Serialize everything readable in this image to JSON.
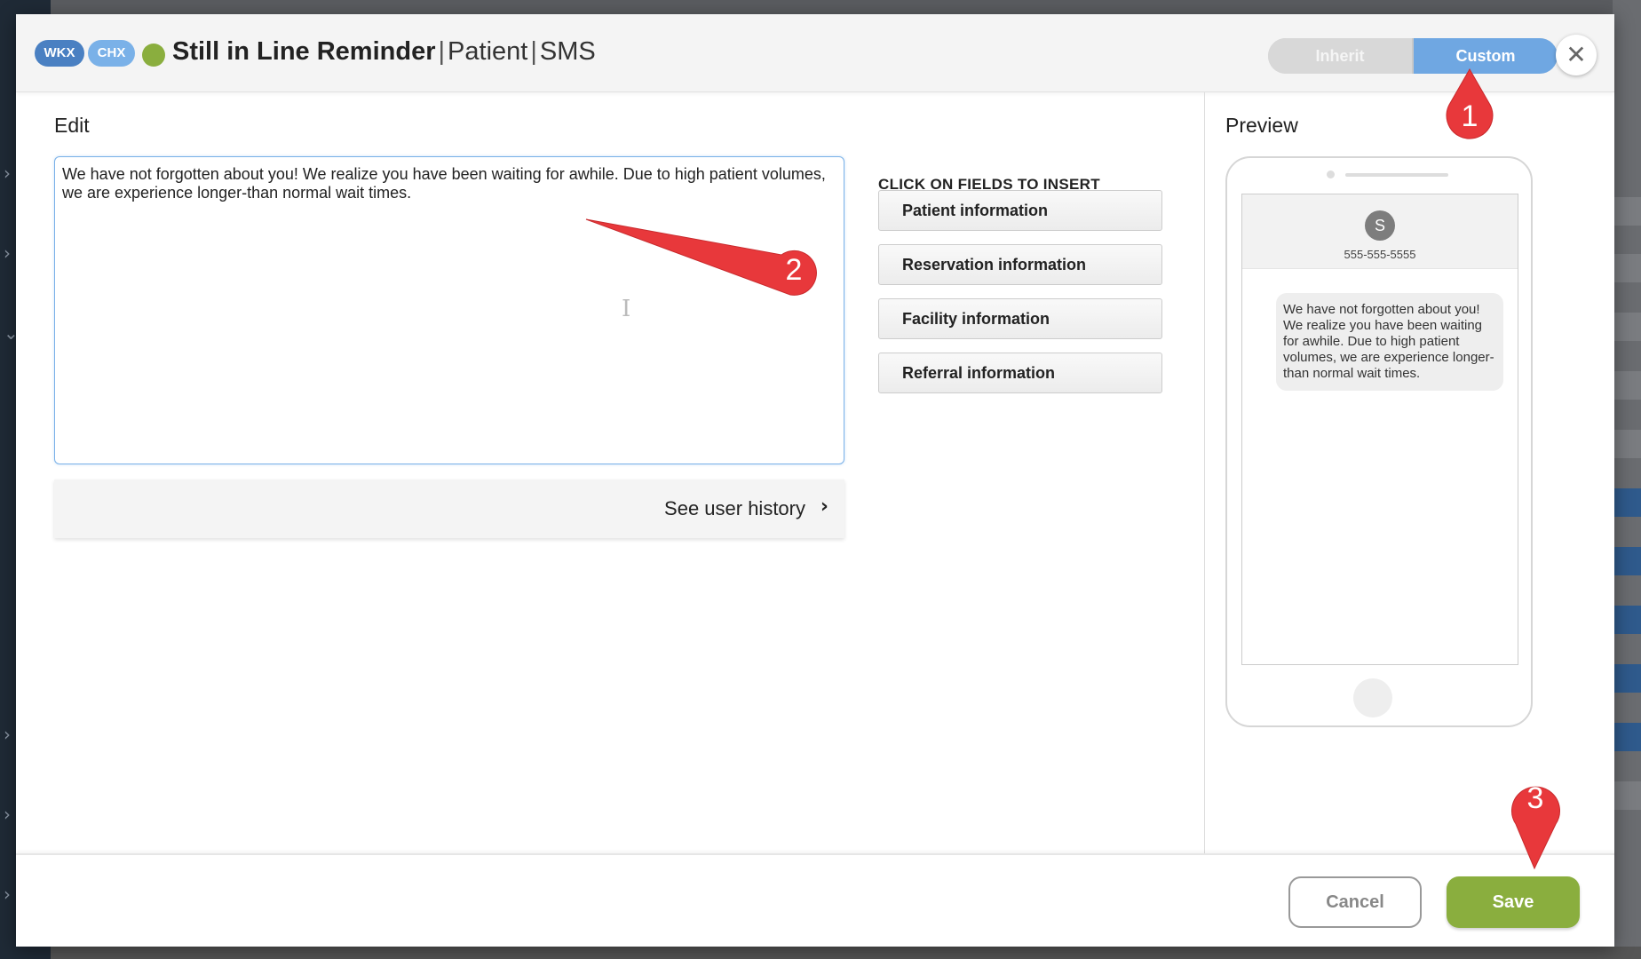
{
  "header": {
    "badges": [
      "WKX",
      "CHX"
    ],
    "title": "Still in Line Reminder",
    "separator": "|",
    "audience": "Patient",
    "channel": "SMS",
    "toggle": {
      "inherit_label": "Inherit",
      "custom_label": "Custom",
      "selected": "Custom"
    },
    "close_icon": "close-icon"
  },
  "edit": {
    "title": "Edit",
    "message": "We have not forgotten about you!  We realize you have been waiting for awhile.  Due to high patient volumes, we are experience longer-than normal wait times.",
    "history_label": "See user history"
  },
  "fields": {
    "title": "CLICK ON FIELDS TO INSERT",
    "items": [
      "Patient information",
      "Reservation information",
      "Facility information",
      "Referral information"
    ]
  },
  "preview": {
    "title": "Preview",
    "avatar_letter": "S",
    "phone_number": "555-555-5555",
    "bubble_text": "We have not forgotten about you! We realize you have been waiting for awhile. Due to high patient volumes, we are experience longer-than normal wait times."
  },
  "footer": {
    "cancel_label": "Cancel",
    "save_label": "Save"
  },
  "annotations": [
    "1",
    "2",
    "3"
  ],
  "colors": {
    "accent_blue": "#6fa7e2",
    "badge_wkx": "#4a80c2",
    "badge_chx": "#7ab1e8",
    "status_green": "#8aae3e",
    "save_green": "#8aae3e",
    "annotation_red": "#e8383b"
  }
}
